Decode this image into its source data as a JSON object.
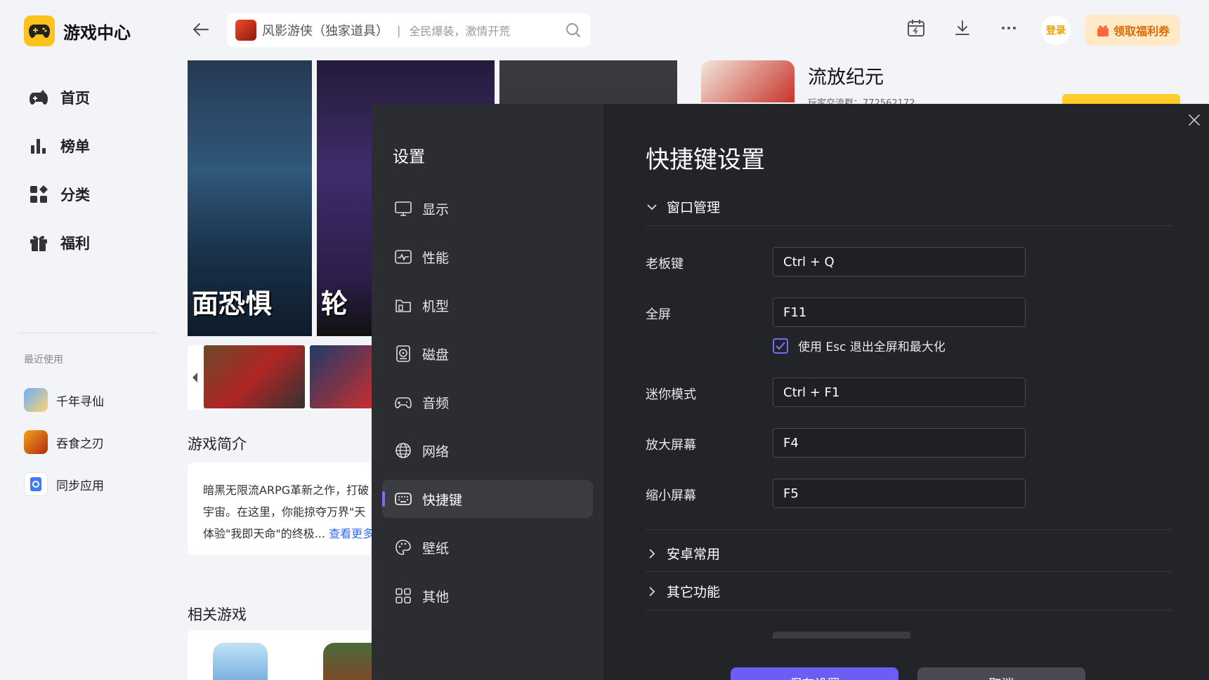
{
  "app": {
    "title": "游戏中心",
    "accent": "#ffc21a"
  },
  "nav": [
    {
      "label": "首页",
      "icon": "gamepad-icon"
    },
    {
      "label": "榜单",
      "icon": "chart-icon"
    },
    {
      "label": "分类",
      "icon": "grid-icon"
    },
    {
      "label": "福利",
      "icon": "gift-icon"
    }
  ],
  "recent": {
    "label": "最近使用",
    "items": [
      {
        "label": "千年寻仙"
      },
      {
        "label": "吞食之刃"
      },
      {
        "label": "同步应用"
      }
    ]
  },
  "search": {
    "game": "风影游侠（独家道具）",
    "separator": "|",
    "slogan": "全民爆装，激情开荒"
  },
  "topbar": {
    "login": "登录",
    "coupon": "领取福利券"
  },
  "banner": {
    "text1": "面恐惧",
    "text2": "轮"
  },
  "game": {
    "title": "流放纪元",
    "group": "玩家交流群：772562172"
  },
  "intro": {
    "title": "游戏简介",
    "line1": "暗黑无限流ARPG革新之作，打破",
    "line2": "宇宙。在这里，你能掠夺万界\"天",
    "line3": "体验\"我即天命\"的终极...",
    "more": "查看更多"
  },
  "related": {
    "title": "相关游戏"
  },
  "settings": {
    "title": "设置",
    "accent": "#7b6cf6",
    "menu": [
      {
        "label": "显示",
        "icon": "monitor-icon"
      },
      {
        "label": "性能",
        "icon": "performance-icon"
      },
      {
        "label": "机型",
        "icon": "folder-icon"
      },
      {
        "label": "磁盘",
        "icon": "disk-icon"
      },
      {
        "label": "音频",
        "icon": "controller-icon"
      },
      {
        "label": "网络",
        "icon": "globe-icon"
      },
      {
        "label": "快捷键",
        "icon": "keyboard-icon",
        "active": true
      },
      {
        "label": "壁纸",
        "icon": "palette-icon"
      },
      {
        "label": "其他",
        "icon": "apps-icon"
      }
    ],
    "heading": "快捷键设置",
    "groups": {
      "window": "窗口管理",
      "android": "安卓常用",
      "other": "其它功能"
    },
    "shortcuts": [
      {
        "label": "老板键",
        "value": "Ctrl + Q"
      },
      {
        "label": "全屏",
        "value": "F11"
      },
      {
        "label": "迷你模式",
        "value": "Ctrl + F1"
      },
      {
        "label": "放大屏幕",
        "value": "F4"
      },
      {
        "label": "缩小屏幕",
        "value": "F5"
      }
    ],
    "esc_option": {
      "label": "使用 Esc 退出全屏和最大化",
      "checked": true
    },
    "save": "保存设置",
    "cancel": "取消"
  }
}
